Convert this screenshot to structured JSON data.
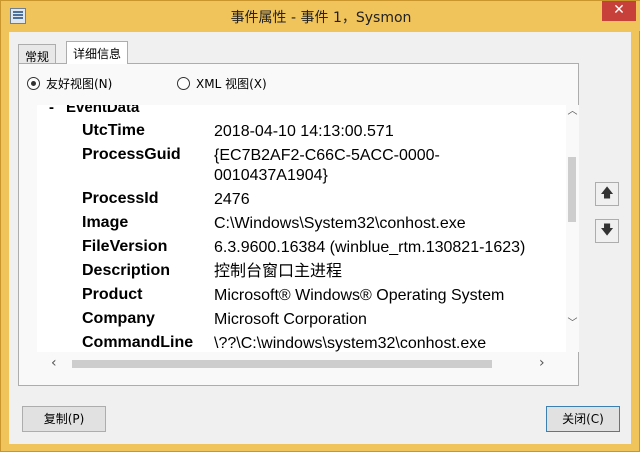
{
  "window": {
    "title": "事件属性 - 事件 1，Sysmon",
    "close_label": "✕"
  },
  "tabs": [
    {
      "label": "常规"
    },
    {
      "label": "详细信息"
    }
  ],
  "view_options": {
    "friendly": "友好视图(N)",
    "xml": "XML 视图(X)",
    "selected": "friendly"
  },
  "event_data": {
    "section_label": "EventData",
    "toggle": "-",
    "fields": [
      {
        "key": "UtcTime",
        "value": "2018-04-10 14:13:00.571"
      },
      {
        "key": "ProcessGuid",
        "value": "{EC7B2AF2-C66C-5ACC-0000-0010437A1904}"
      },
      {
        "key": "ProcessId",
        "value": "2476"
      },
      {
        "key": "Image",
        "value": "C:\\Windows\\System32\\conhost.exe"
      },
      {
        "key": "FileVersion",
        "value": "6.3.9600.16384 (winblue_rtm.130821-1623)"
      },
      {
        "key": "Description",
        "value": "控制台窗口主进程"
      },
      {
        "key": "Product",
        "value": "Microsoft® Windows® Operating System"
      },
      {
        "key": "Company",
        "value": "Microsoft Corporation"
      },
      {
        "key": "CommandLine",
        "value": "\\??\\C:\\windows\\system32\\conhost.exe"
      }
    ]
  },
  "nav": {
    "up_icon": "arrow-up-icon",
    "down_icon": "arrow-down-icon"
  },
  "buttons": {
    "copy": "复制(P)",
    "close": "关闭(C)"
  }
}
